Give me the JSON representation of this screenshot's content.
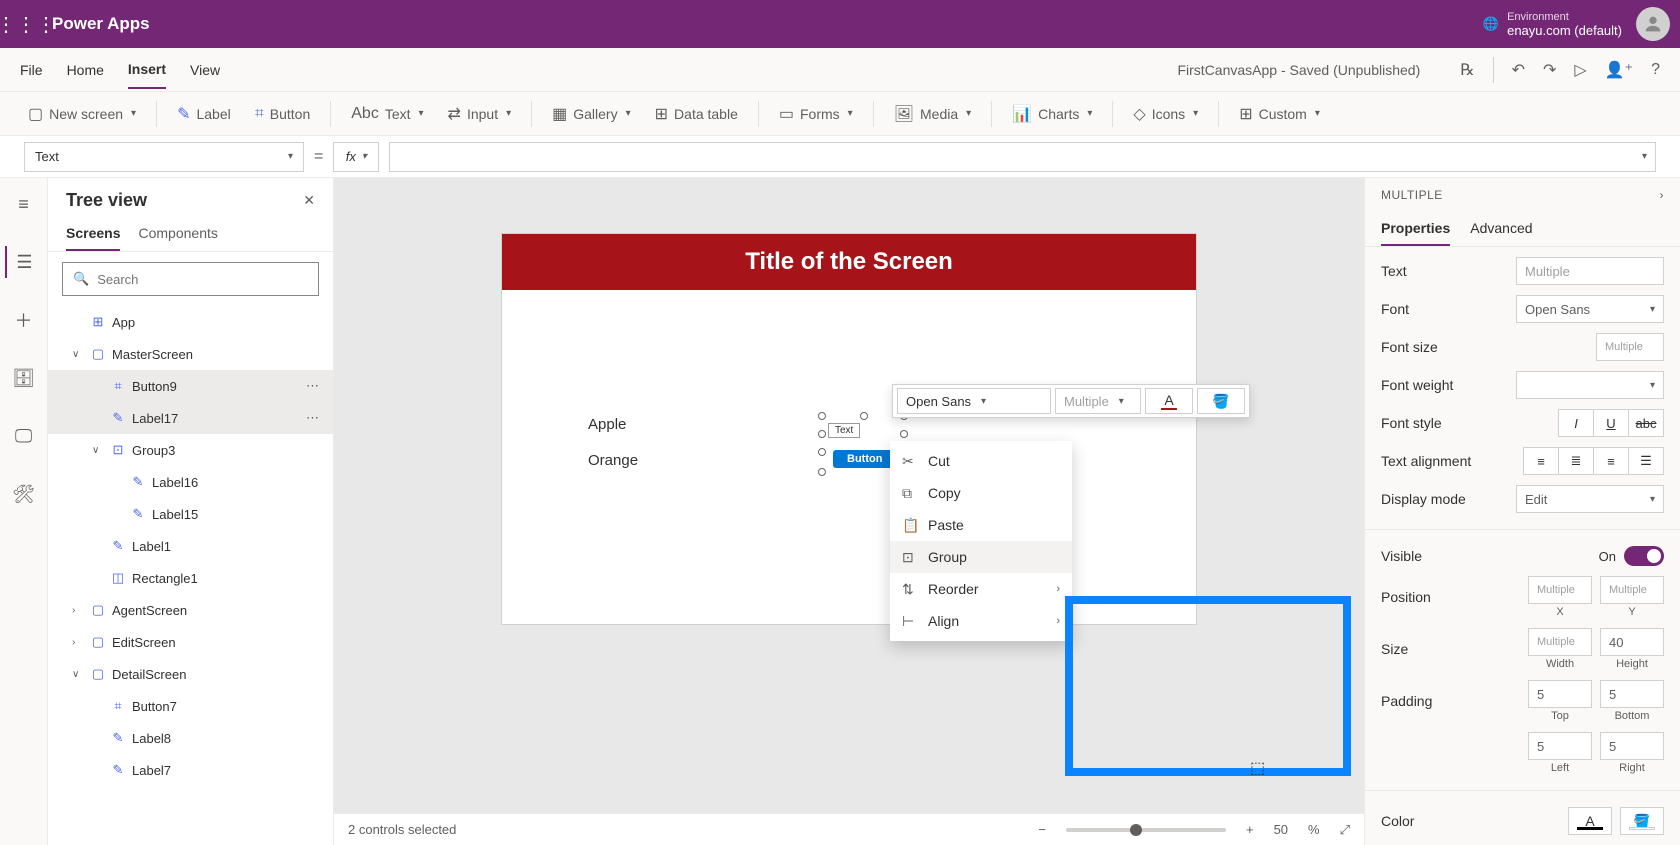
{
  "titlebar": {
    "app_name": "Power Apps",
    "env_label": "Environment",
    "env_name": "enayu.com (default)"
  },
  "menubar": {
    "items": [
      "File",
      "Home",
      "Insert",
      "View"
    ],
    "active_index": 2,
    "doc_title": "FirstCanvasApp - Saved (Unpublished)"
  },
  "ribbon": {
    "new_screen": "New screen",
    "label": "Label",
    "button": "Button",
    "text": "Text",
    "input": "Input",
    "gallery": "Gallery",
    "data_table": "Data table",
    "forms": "Forms",
    "media": "Media",
    "charts": "Charts",
    "icons": "Icons",
    "custom": "Custom"
  },
  "formulabar": {
    "property": "Text",
    "equals": "=",
    "fx": "fx"
  },
  "tree": {
    "title": "Tree view",
    "tabs": [
      "Screens",
      "Components"
    ],
    "search_placeholder": "Search",
    "items": [
      {
        "label": "App",
        "icon": "⊞",
        "indent": 1
      },
      {
        "label": "MasterScreen",
        "icon": "▢",
        "indent": 1,
        "caret": "∨"
      },
      {
        "label": "Button9",
        "icon": "⌗",
        "indent": 2,
        "selected": true,
        "dots": "⋯"
      },
      {
        "label": "Label17",
        "icon": "✎",
        "indent": 2,
        "selected": true,
        "dots": "⋯"
      },
      {
        "label": "Group3",
        "icon": "⊡",
        "indent": 2,
        "caret": "∨"
      },
      {
        "label": "Label16",
        "icon": "✎",
        "indent": 3
      },
      {
        "label": "Label15",
        "icon": "✎",
        "indent": 3
      },
      {
        "label": "Label1",
        "icon": "✎",
        "indent": 2
      },
      {
        "label": "Rectangle1",
        "icon": "◫",
        "indent": 2
      },
      {
        "label": "AgentScreen",
        "icon": "▢",
        "indent": 1,
        "caret": "›"
      },
      {
        "label": "EditScreen",
        "icon": "▢",
        "indent": 1,
        "caret": "›"
      },
      {
        "label": "DetailScreen",
        "icon": "▢",
        "indent": 1,
        "caret": "∨"
      },
      {
        "label": "Button7",
        "icon": "⌗",
        "indent": 2
      },
      {
        "label": "Label8",
        "icon": "✎",
        "indent": 2
      },
      {
        "label": "Label7",
        "icon": "✎",
        "indent": 2
      }
    ]
  },
  "canvas": {
    "screen_title": "Title of the Screen",
    "label_apple": "Apple",
    "label_orange": "Orange",
    "sel_label_text": "Text",
    "sel_button_text": "Button"
  },
  "float_format": {
    "font": "Open Sans",
    "size": "Multiple"
  },
  "context_menu": {
    "items": [
      {
        "icon": "✂",
        "label": "Cut"
      },
      {
        "icon": "⧉",
        "label": "Copy"
      },
      {
        "icon": "📋",
        "label": "Paste"
      },
      {
        "icon": "⊡",
        "label": "Group",
        "hover": true
      },
      {
        "icon": "⇅",
        "label": "Reorder",
        "sub": true
      },
      {
        "icon": "⊢",
        "label": "Align",
        "sub": true
      }
    ]
  },
  "status": {
    "selected": "2 controls selected",
    "zoom": "50",
    "zoom_pct": "%"
  },
  "properties": {
    "header": "MULTIPLE",
    "tabs": [
      "Properties",
      "Advanced"
    ],
    "text_label": "Text",
    "text_value": "Multiple",
    "font_label": "Font",
    "font_value": "Open Sans",
    "font_size_label": "Font size",
    "font_size_value": "Multiple",
    "font_weight_label": "Font weight",
    "font_style_label": "Font style",
    "text_align_label": "Text alignment",
    "display_mode_label": "Display mode",
    "display_mode_value": "Edit",
    "visible_label": "Visible",
    "visible_on": "On",
    "position_label": "Position",
    "pos_x": "Multiple",
    "pos_y": "Multiple",
    "pos_x_cap": "X",
    "pos_y_cap": "Y",
    "size_label": "Size",
    "size_w": "Multiple",
    "size_h": "40",
    "size_w_cap": "Width",
    "size_h_cap": "Height",
    "padding_label": "Padding",
    "pad_t": "5",
    "pad_b": "5",
    "pad_t_cap": "Top",
    "pad_b_cap": "Bottom",
    "pad_l": "5",
    "pad_r": "5",
    "pad_l_cap": "Left",
    "pad_r_cap": "Right",
    "color_label": "Color"
  }
}
